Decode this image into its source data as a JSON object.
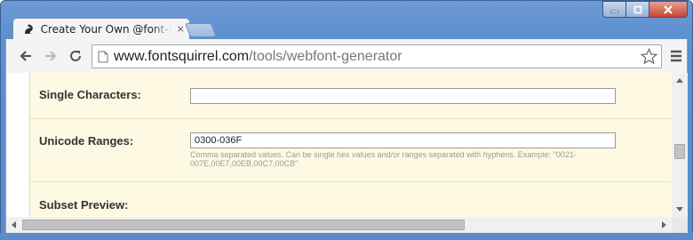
{
  "tab": {
    "title": "Create Your Own @font-face Kits | Font Squirrel",
    "close_glyph": "×",
    "favicon": "squirrel-icon"
  },
  "window_controls": [
    "minimize-icon",
    "maximize-icon",
    "close-icon"
  ],
  "toolbar": {
    "back_icon": "back-arrow-icon",
    "forward_icon": "forward-arrow-icon",
    "reload_icon": "reload-icon",
    "url_host": "www.fontsquirrel.com",
    "url_path": "/tools/webfont-generator",
    "bookmark_icon": "star-icon",
    "menu_icon": "hamburger-menu-icon"
  },
  "form": {
    "single_characters": {
      "label": "Single Characters:",
      "value": ""
    },
    "unicode_ranges": {
      "label": "Unicode Ranges:",
      "value": "0300-036F",
      "help": "Comma separated values. Can be single hex values and/or ranges separated with hyphens. Example: \"0021-007E,00E7,00EB,00C7,00CB\""
    },
    "subset_preview": {
      "label": "Subset Preview:"
    }
  },
  "colors": {
    "frame": "#5a8bcb",
    "content_background": "#fdf9e2",
    "row_divider": "#e7e1c6",
    "help_text": "#9c9c9c"
  }
}
